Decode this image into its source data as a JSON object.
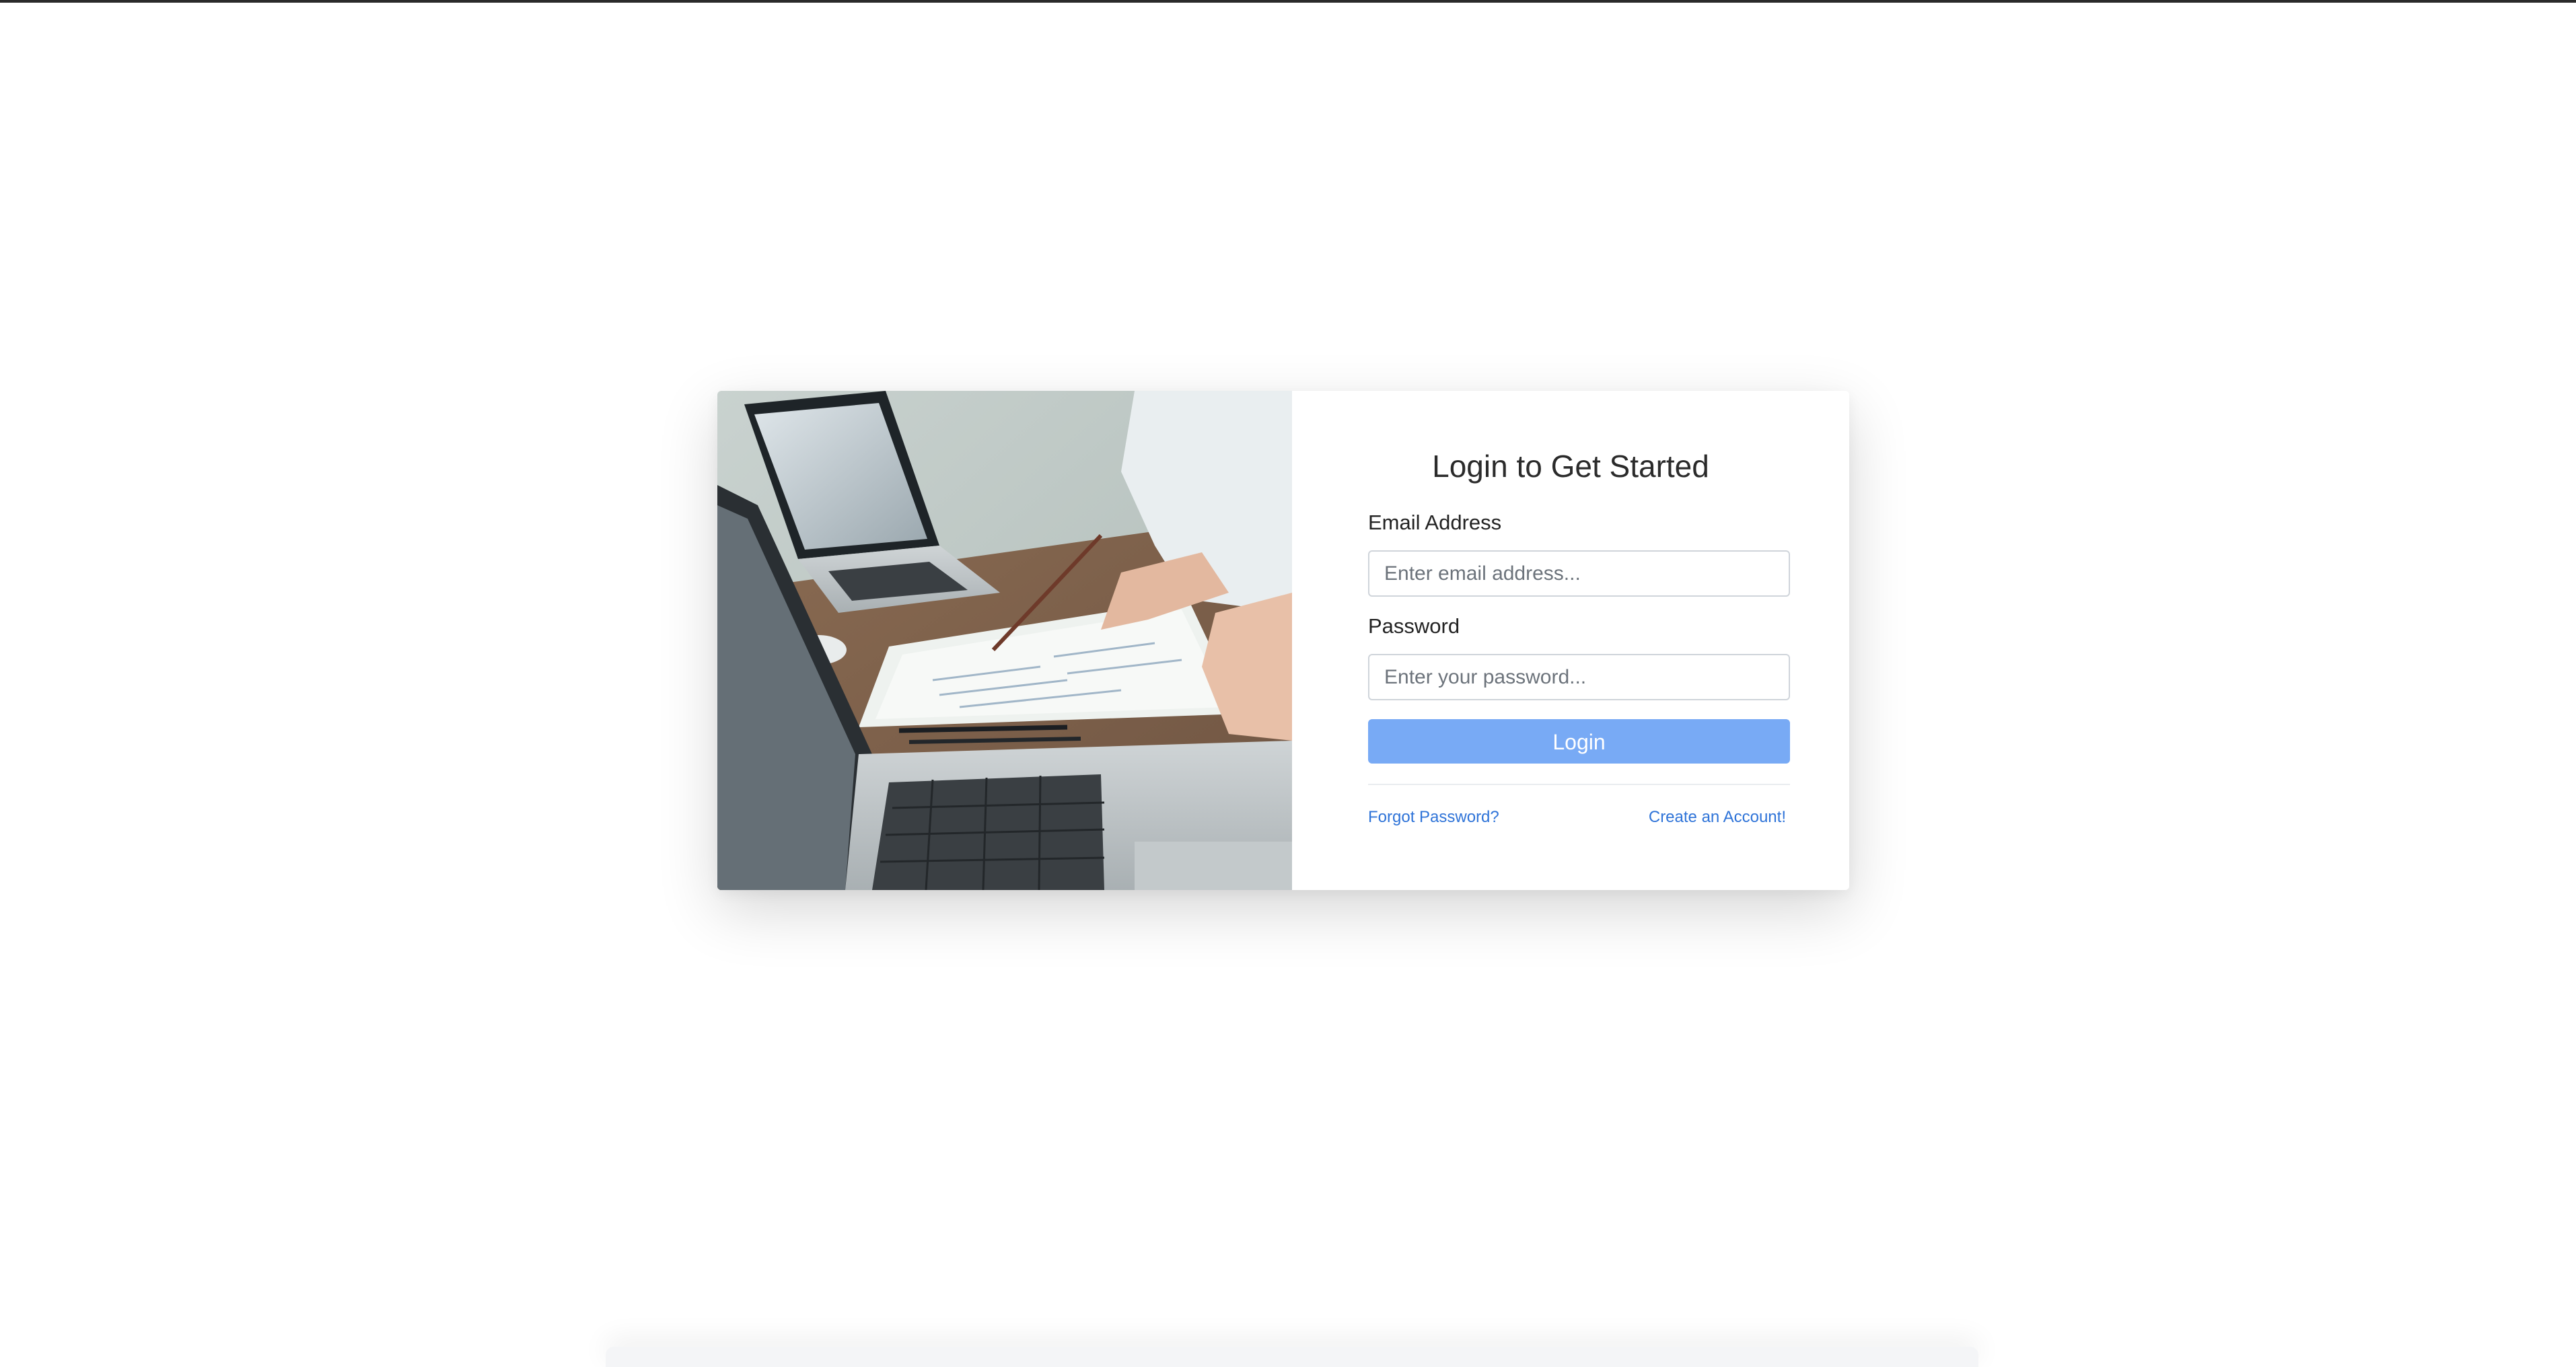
{
  "login": {
    "title": "Login to Get Started",
    "email": {
      "label": "Email Address",
      "placeholder": "Enter email address...",
      "value": ""
    },
    "password": {
      "label": "Password",
      "placeholder": "Enter your password...",
      "value": ""
    },
    "submit_label": "Login",
    "forgot_label": "Forgot Password?",
    "register_label": "Create an Account!"
  },
  "colors": {
    "button": "#78aaf5",
    "link": "#2e73d8",
    "title": "#2b2b2b"
  }
}
